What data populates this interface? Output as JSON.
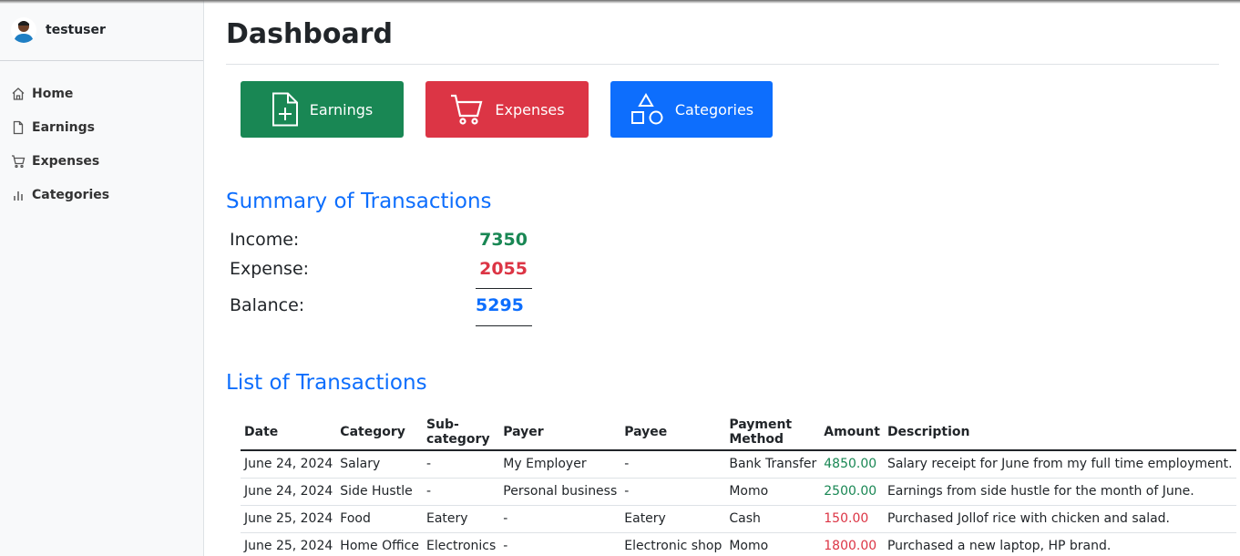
{
  "user": {
    "name": "testuser"
  },
  "sidebar": {
    "items": [
      {
        "label": "Home",
        "icon": "home-icon"
      },
      {
        "label": "Earnings",
        "icon": "file-icon"
      },
      {
        "label": "Expenses",
        "icon": "cart-icon"
      },
      {
        "label": "Categories",
        "icon": "bar-chart-icon"
      }
    ]
  },
  "page": {
    "title": "Dashboard"
  },
  "buttons": {
    "earnings": "Earnings",
    "expenses": "Expenses",
    "categories": "Categories"
  },
  "colors": {
    "green": "#198754",
    "red": "#dc3545",
    "blue": "#0d6efd"
  },
  "summary": {
    "title": "Summary of Transactions",
    "income_label": "Income:",
    "income_value": "7350",
    "expense_label": "Expense:",
    "expense_value": "2055",
    "balance_label": "Balance:",
    "balance_value": "5295"
  },
  "transactions": {
    "title": "List of Transactions",
    "headers": [
      "Date",
      "Category",
      "Sub-category",
      "Payer",
      "Payee",
      "Payment Method",
      "Amount",
      "Description"
    ],
    "rows": [
      [
        "June 24, 2024",
        "Salary",
        "-",
        "My Employer",
        "-",
        "Bank Transfer",
        "4850.00",
        "Salary receipt for June from my full time employment."
      ],
      [
        "June 24, 2024",
        "Side Hustle",
        "-",
        "Personal business",
        "-",
        "Momo",
        "2500.00",
        "Earnings from side hustle for the month of June."
      ],
      [
        "June 25, 2024",
        "Food",
        "Eatery",
        "-",
        "Eatery",
        "Cash",
        "150.00",
        "Purchased Jollof rice with chicken and salad."
      ],
      [
        "June 25, 2024",
        "Home Office",
        "Electronics",
        "-",
        "Electronic shop",
        "Momo",
        "1800.00",
        "Purchased a new laptop, HP brand."
      ]
    ]
  }
}
